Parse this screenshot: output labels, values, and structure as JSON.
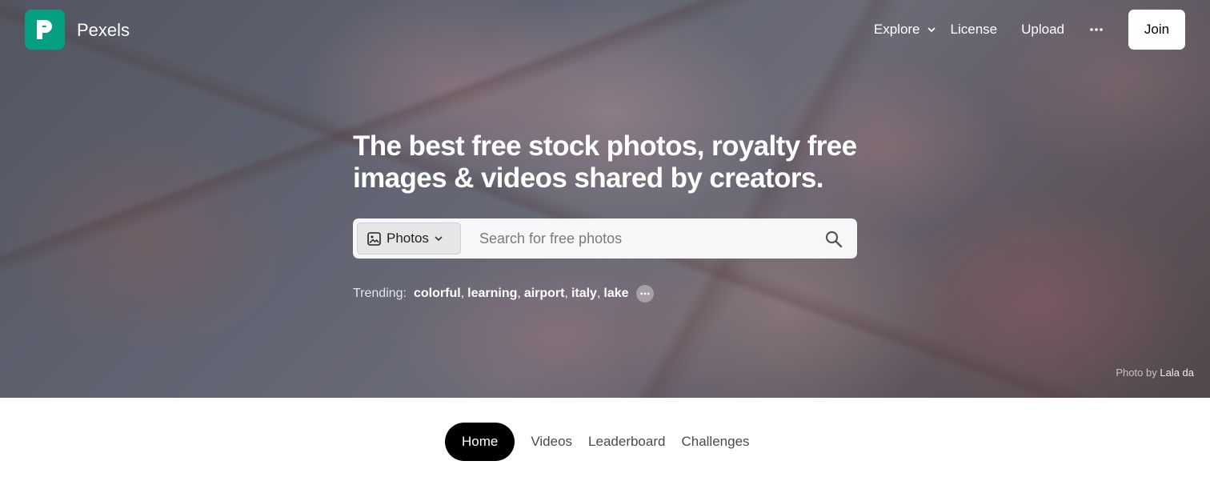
{
  "brand": {
    "name": "Pexels",
    "logo_color": "#05a081"
  },
  "nav": {
    "explore": "Explore",
    "license": "License",
    "upload": "Upload",
    "more_icon": "ellipsis-icon",
    "join": "Join"
  },
  "hero": {
    "headline_line1": "The best free stock photos, royalty free",
    "headline_line2": "images & videos shared by creators.",
    "search": {
      "type_label": "Photos",
      "placeholder": "Search for free photos"
    },
    "trending": {
      "label": "Trending:",
      "tags": [
        "colorful",
        "learning",
        "airport",
        "italy",
        "lake"
      ]
    },
    "credit": {
      "prefix": "Photo by",
      "author": "Lala da"
    }
  },
  "tabs": [
    "Home",
    "Videos",
    "Leaderboard",
    "Challenges"
  ],
  "colors": {
    "accent": "#05a081",
    "active_tab_bg": "#000000"
  }
}
